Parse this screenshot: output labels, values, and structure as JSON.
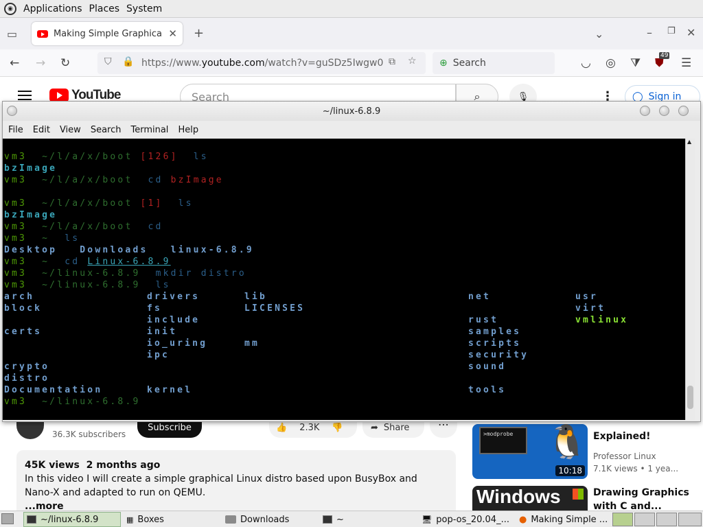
{
  "top_panel": {
    "menus": [
      "Applications",
      "Places",
      "System"
    ]
  },
  "firefox": {
    "tab": {
      "title": "Making Simple Graphical Li"
    },
    "url": {
      "prefix": "https://www.",
      "host": "youtube.com",
      "path": "/watch?v=guSDz5Iwgw0"
    },
    "search_placeholder": "Search",
    "extension_badge": "49"
  },
  "youtube": {
    "logo_text": "YouTube",
    "search_placeholder": "Search",
    "sign_in": "Sign in",
    "subscribers": "36.3K subscribers",
    "subscribe": "Subscribe",
    "likes": "2.3K",
    "share": "Share",
    "description": {
      "views": "45K views",
      "age": "2 months ago",
      "text": "In this video I will create a simple graphical Linux distro based upon BusyBox and Nano-X and adapted to run on QEMU.",
      "more": "...more"
    },
    "recommendations": [
      {
        "title": "Explained!",
        "channel": "Professor Linux",
        "meta": "7.1K views  •  1 yea...",
        "duration": "10:18",
        "thumb_text": ">modprobe"
      },
      {
        "title": "Drawing Graphics with C and...",
        "thumb_text": "Windows"
      }
    ]
  },
  "terminal": {
    "title": "~/linux-6.8.9",
    "menu": [
      "File",
      "Edit",
      "View",
      "Search",
      "Terminal",
      "Help"
    ],
    "lines": [
      {
        "seg": [
          [
            "vm3",
            "c-green"
          ],
          [
            "  ~/l/a/x/boot ",
            "c-gdim"
          ],
          [
            "[126]",
            "c-red"
          ],
          [
            "  ls",
            "c-blue"
          ]
        ]
      },
      {
        "seg": [
          [
            "bzImage",
            "c-cyan"
          ]
        ]
      },
      {
        "seg": [
          [
            "vm3",
            "c-green"
          ],
          [
            "  ~/l/a/x/boot  ",
            "c-gdim"
          ],
          [
            "cd ",
            "c-blue"
          ],
          [
            "bzImage",
            "c-red"
          ]
        ]
      },
      {
        "seg": []
      },
      {
        "seg": [
          [
            "vm3",
            "c-green"
          ],
          [
            "  ~/l/a/x/boot ",
            "c-gdim"
          ],
          [
            "[1]",
            "c-red"
          ],
          [
            "  ls",
            "c-blue"
          ]
        ]
      },
      {
        "seg": [
          [
            "bzImage",
            "c-cyan"
          ]
        ]
      },
      {
        "seg": [
          [
            "vm3",
            "c-green"
          ],
          [
            "  ~/l/a/x/boot  ",
            "c-gdim"
          ],
          [
            "cd",
            "c-blue"
          ]
        ]
      },
      {
        "seg": [
          [
            "vm3",
            "c-green"
          ],
          [
            "  ~  ",
            "c-gdim"
          ],
          [
            "ls",
            "c-blue"
          ]
        ]
      },
      {
        "seg": [
          [
            "Desktop   Downloads   linux-6.8.9",
            "c-dir"
          ]
        ]
      },
      {
        "seg": [
          [
            "vm3",
            "c-green"
          ],
          [
            "  ~  ",
            "c-gdim"
          ],
          [
            "cd ",
            "c-blue"
          ],
          [
            "Linux-6.8.9",
            "c-link"
          ]
        ]
      },
      {
        "seg": [
          [
            "vm3",
            "c-green"
          ],
          [
            "  ~/linux-6.8.9  ",
            "c-gdim"
          ],
          [
            "mkdir distro",
            "c-blue"
          ]
        ]
      },
      {
        "seg": [
          [
            "vm3",
            "c-green"
          ],
          [
            "  ~/linux-6.8.9  ",
            "c-gdim"
          ],
          [
            "ls",
            "c-blue"
          ]
        ]
      },
      {
        "cols": [
          [
            "arch",
            "c-dir"
          ],
          [
            "drivers",
            "c-dir"
          ],
          [
            "lib",
            "c-dir"
          ],
          [
            "net",
            "c-dir"
          ],
          [
            "usr",
            "c-dir"
          ]
        ]
      },
      {
        "cols": [
          [
            "block",
            "c-dir"
          ],
          [
            "fs",
            "c-dir"
          ],
          [
            "LICENSES",
            "c-dir"
          ],
          [
            "",
            ""
          ],
          [
            "virt",
            "c-dir"
          ]
        ]
      },
      {
        "cols": [
          [
            "",
            ""
          ],
          [
            "include",
            "c-dir"
          ],
          [
            "",
            ""
          ],
          [
            "rust",
            "c-dir"
          ],
          [
            "vmlinux",
            "c-exe"
          ]
        ]
      },
      {
        "cols": [
          [
            "certs",
            "c-dir"
          ],
          [
            "init",
            "c-dir"
          ],
          [
            "",
            ""
          ],
          [
            "samples",
            "c-dir"
          ],
          [
            "",
            ""
          ]
        ]
      },
      {
        "cols": [
          [
            "",
            ""
          ],
          [
            "io_uring",
            "c-dir"
          ],
          [
            "mm",
            "c-dir"
          ],
          [
            "scripts",
            "c-dir"
          ],
          [
            "",
            ""
          ]
        ]
      },
      {
        "cols": [
          [
            "",
            ""
          ],
          [
            "ipc",
            "c-dir"
          ],
          [
            "",
            ""
          ],
          [
            "security",
            "c-dir"
          ],
          [
            "",
            ""
          ]
        ]
      },
      {
        "cols": [
          [
            "crypto",
            "c-dir"
          ],
          [
            "",
            ""
          ],
          [
            "",
            ""
          ],
          [
            "sound",
            "c-dir"
          ],
          [
            "",
            ""
          ]
        ]
      },
      {
        "cols": [
          [
            "distro",
            "c-dir"
          ],
          [
            "",
            ""
          ],
          [
            "",
            ""
          ],
          [
            "",
            ""
          ],
          [
            "",
            ""
          ]
        ]
      },
      {
        "cols": [
          [
            "Documentation",
            "c-dir"
          ],
          [
            "kernel",
            "c-dir"
          ],
          [
            "",
            ""
          ],
          [
            "tools",
            "c-dir"
          ],
          [
            "",
            ""
          ]
        ]
      },
      {
        "seg": [
          [
            "vm3",
            "c-green"
          ],
          [
            "  ~/linux-6.8.9",
            "c-gdim"
          ]
        ]
      }
    ]
  },
  "taskbar": {
    "tasks": [
      {
        "label": "~/linux-6.8.9"
      },
      {
        "label": "Boxes"
      },
      {
        "label": "Downloads"
      },
      {
        "label": "~"
      },
      {
        "label": "pop-os_20.04_..."
      },
      {
        "label": "Making Simple ..."
      }
    ]
  }
}
